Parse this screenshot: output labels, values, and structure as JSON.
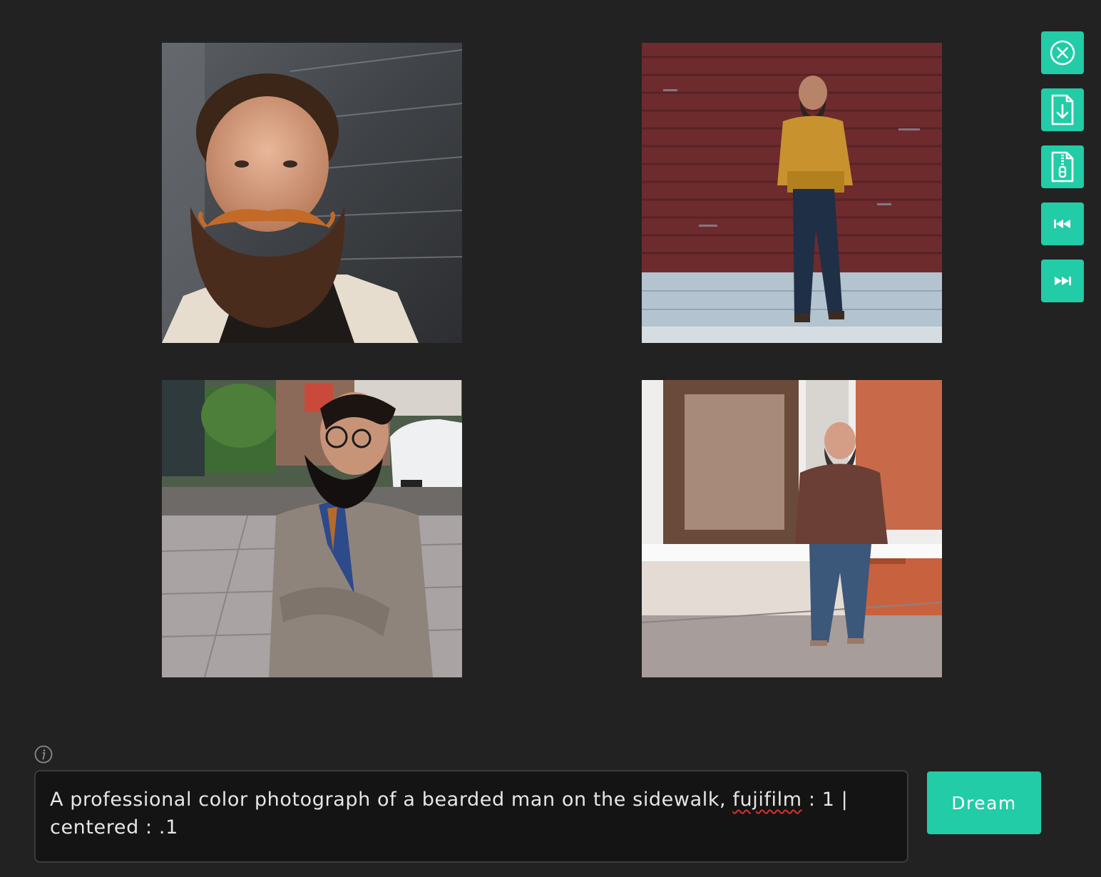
{
  "gallery": {
    "images": [
      {
        "alt": "image-1"
      },
      {
        "alt": "image-2"
      },
      {
        "alt": "image-3"
      },
      {
        "alt": "image-4"
      }
    ]
  },
  "toolbar": {
    "buttons": [
      {
        "icon": "close-circle-icon"
      },
      {
        "icon": "file-download-icon"
      },
      {
        "icon": "file-zip-icon"
      },
      {
        "icon": "skip-back-icon"
      },
      {
        "icon": "skip-forward-icon"
      }
    ],
    "accent": "#22cca7"
  },
  "prompt": {
    "text_before": "A professional color photograph of a bearded man on the sidewalk, ",
    "misspelled_word": "fujifilm",
    "text_after": " : 1 | centered : .1"
  },
  "dream_button": {
    "label": "Dream"
  },
  "colors": {
    "background": "#222222",
    "prompt_background": "#141414",
    "accent": "#22cca7"
  }
}
